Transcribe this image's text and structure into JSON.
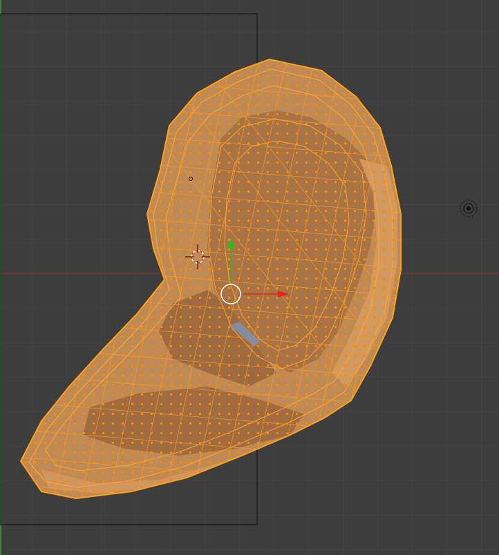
{
  "viewport": {
    "mode": "edit-mode",
    "shading": "solid",
    "background_color": "#3d3d3d",
    "grid_color": "#464646",
    "x_axis_color": "#9a2f2f",
    "y_axis_color": "#3d8a3d"
  },
  "mesh": {
    "name": "ear",
    "selection_state": "all-selected",
    "face_color": "#c08a54",
    "edge_color": "#ff9a1c",
    "vertex_color": "#ff8a00"
  },
  "gizmo": {
    "type": "translate",
    "x_arrow_color": "#e52222",
    "y_arrow_color": "#22c022",
    "center_ring_color": "#ffffff"
  },
  "icons": {
    "cursor": "3d-cursor-icon",
    "light": "light-lamp-icon",
    "pivot": "pivot-point-icon"
  }
}
